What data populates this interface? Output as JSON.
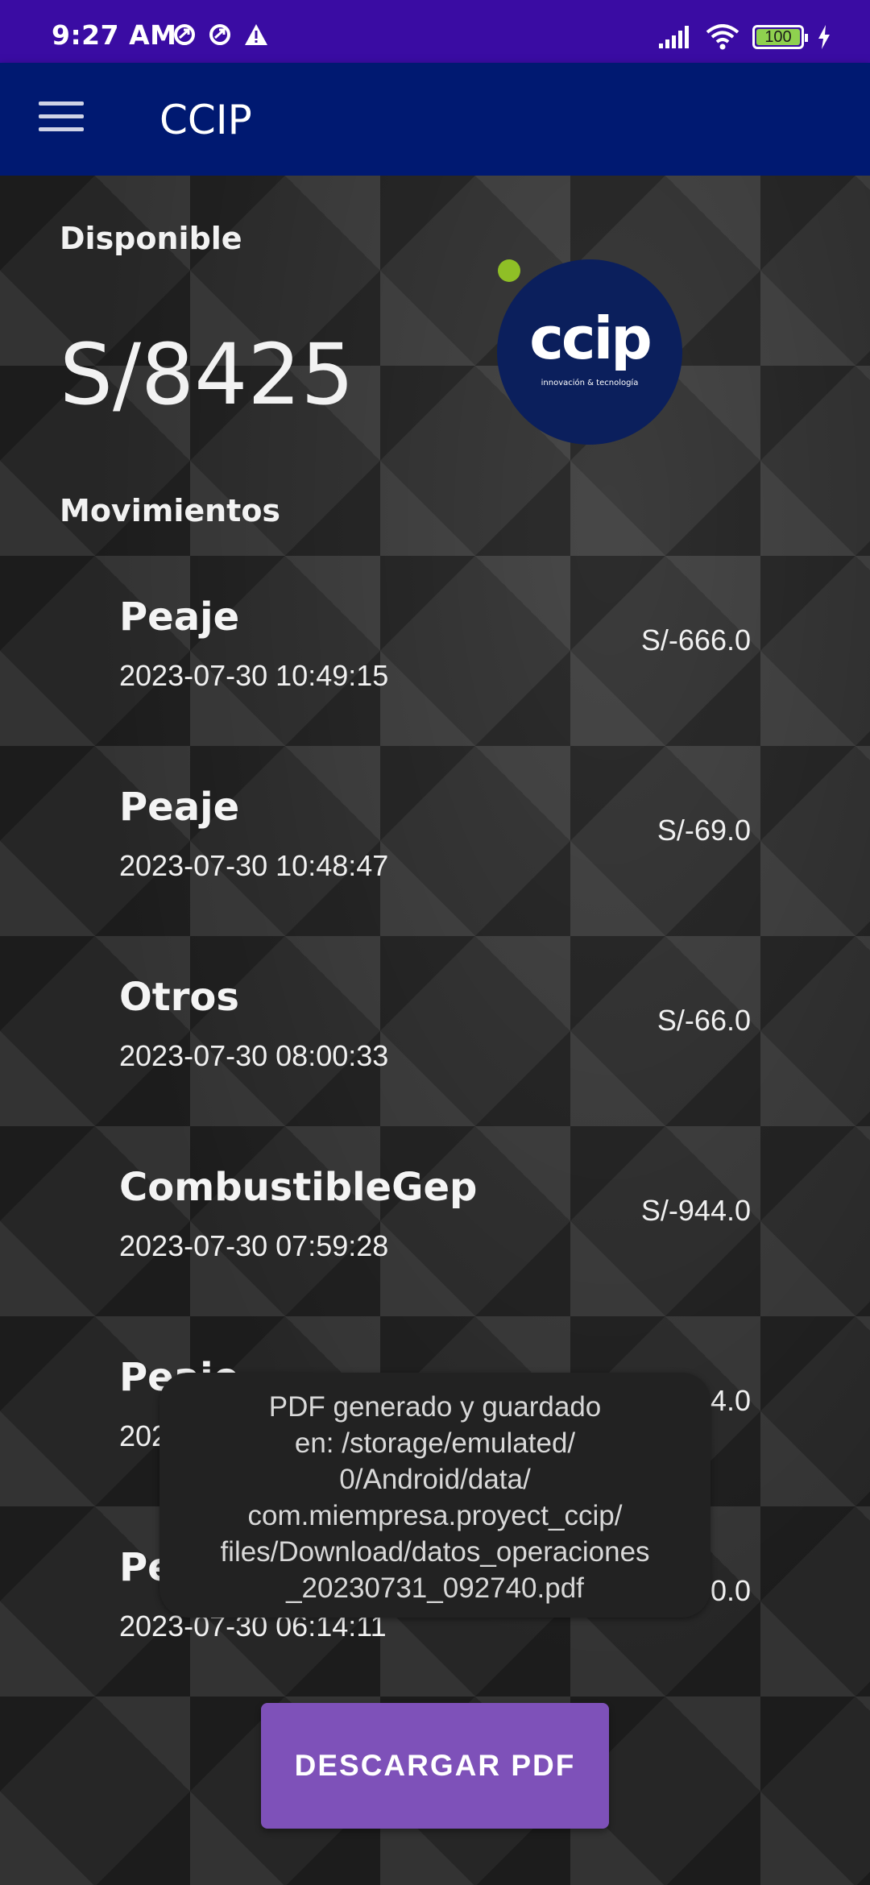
{
  "status_bar": {
    "time": "9:27 AM",
    "battery": "100",
    "icons_left": [
      "data-saver-icon",
      "data-saver-icon",
      "warning-icon"
    ],
    "icons_right": [
      "signal-icon",
      "wifi-icon",
      "battery-icon",
      "charging-icon"
    ]
  },
  "app_bar": {
    "title": "CCIP",
    "menu_icon": "hamburger-menu-icon"
  },
  "balance": {
    "label": "Disponible",
    "amount": "S/8425"
  },
  "logo": {
    "text": "ccip",
    "subtext": "innovación & tecnología",
    "bg_color": "#0b1f5c",
    "dot_color": "#8fbf26"
  },
  "movements": {
    "label": "Movimientos",
    "items": [
      {
        "title": "Peaje",
        "date": "2023-07-30 10:49:15",
        "amount": "S/-666.0"
      },
      {
        "title": "Peaje",
        "date": "2023-07-30 10:48:47",
        "amount": "S/-69.0"
      },
      {
        "title": "Otros",
        "date": "2023-07-30 08:00:33",
        "amount": "S/-66.0"
      },
      {
        "title": "CombustibleGep",
        "date": "2023-07-30 07:59:28",
        "amount": "S/-944.0"
      },
      {
        "title": "Peaje",
        "date": "2023-",
        "amount": "4.0"
      },
      {
        "title": "Pe",
        "date": "2023-07-30 06:14:11",
        "amount": "0.0"
      }
    ]
  },
  "toast": {
    "lines": [
      "PDF generado y guardado",
      "en: /storage/emulated/",
      "0/Android/data/",
      "com.miempresa.proyect_ccip/",
      "files/Download/datos_operaciones",
      "_20230731_092740.pdf"
    ]
  },
  "download_button": {
    "label": "DESCARGAR PDF",
    "color": "#7e51b9"
  },
  "colors": {
    "status_bar": "#3a0ca3",
    "app_bar": "#001971"
  }
}
